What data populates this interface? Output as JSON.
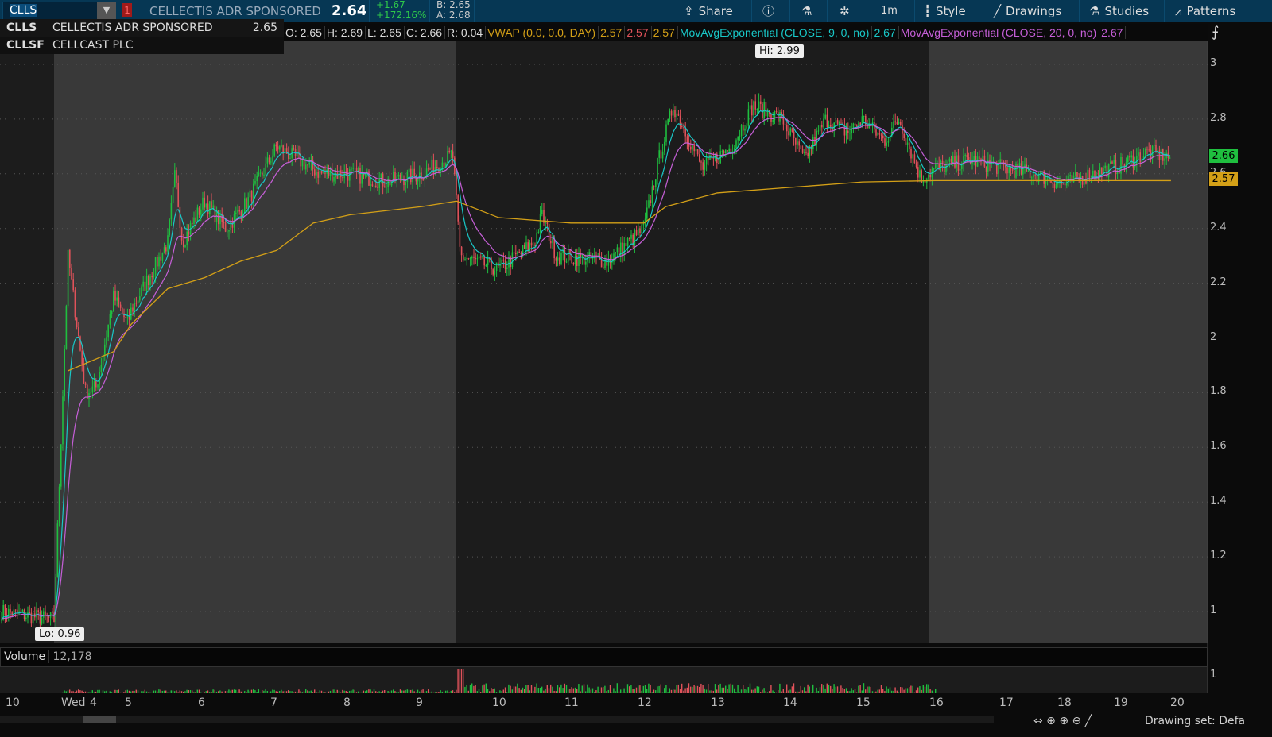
{
  "toolbar": {
    "symbol": "CLLS",
    "alert_count": "1",
    "description": "CELLECTIS ADR SPONSORED",
    "last": "2.64",
    "change": "+1.67",
    "change_pct": "+172.16%",
    "bid": "B: 2.65",
    "ask": "A: 2.68",
    "buttons": {
      "share": "Share",
      "interval": "1m",
      "style": "Style",
      "drawings": "Drawings",
      "studies": "Studies",
      "patterns": "Patterns"
    }
  },
  "dropdown": [
    {
      "symbol": "CLLS",
      "name": "CELLECTIS ADR SPONSORED",
      "price": "2.65"
    },
    {
      "symbol": "CLLSF",
      "name": "CELLCAST PLC",
      "price": ""
    }
  ],
  "legend": {
    "o": "O: 2.65",
    "h": "H: 2.69",
    "l": "L: 2.65",
    "c": "C: 2.66",
    "r": "R: 0.04",
    "vwap": "VWAP (0.0, 0.0, DAY)",
    "vwap_v1": "2.57",
    "vwap_v2": "2.57",
    "vwap_v3": "2.57",
    "ema9": "MovAvgExponential (CLOSE, 9, 0, no)",
    "ema9_v": "2.67",
    "ema20": "MovAvgExponential (CLOSE, 20, 0, no)",
    "ema20_v": "2.67"
  },
  "colors": {
    "up": "#1fbf3f",
    "down": "#e0525a",
    "vwap": "#d4a017",
    "ema9": "#19c8c8",
    "ema20": "#c65fd8"
  },
  "chart_data": {
    "type": "candlestick",
    "title": "CLLS 1m",
    "y_ticks": [
      "3",
      "2.8",
      "2.6",
      "2.4",
      "2.2",
      "2",
      "1.8",
      "1.6",
      "1.4",
      "1.2",
      "1"
    ],
    "ylim": [
      0.9,
      3.08
    ],
    "x_ticks": [
      "10",
      "Wed",
      "4",
      "5",
      "6",
      "7",
      "8",
      "9",
      "10",
      "11",
      "12",
      "13",
      "14",
      "15",
      "16",
      "17",
      "18",
      "19",
      "20"
    ],
    "price_path": [
      [
        3.3,
        1.0
      ],
      [
        3.88,
        0.97
      ],
      [
        3.92,
        2.3
      ],
      [
        3.97,
        1.8
      ],
      [
        4.2,
        1.95
      ],
      [
        4.5,
        2.15
      ],
      [
        4.9,
        2.05
      ],
      [
        5.2,
        2.2
      ],
      [
        5.5,
        2.35
      ],
      [
        5.6,
        2.6
      ],
      [
        5.7,
        2.35
      ],
      [
        6,
        2.5
      ],
      [
        6.3,
        2.4
      ],
      [
        6.6,
        2.5
      ],
      [
        7,
        2.7
      ],
      [
        7.3,
        2.65
      ],
      [
        7.6,
        2.6
      ],
      [
        8,
        2.6
      ],
      [
        8.5,
        2.57
      ],
      [
        9,
        2.6
      ],
      [
        9.4,
        2.67
      ],
      [
        9.5,
        2.3
      ],
      [
        10,
        2.25
      ],
      [
        10.5,
        2.35
      ],
      [
        10.6,
        2.45
      ],
      [
        10.8,
        2.3
      ],
      [
        11.5,
        2.28
      ],
      [
        12,
        2.4
      ],
      [
        12.2,
        2.65
      ],
      [
        12.4,
        2.85
      ],
      [
        12.8,
        2.62
      ],
      [
        13.2,
        2.7
      ],
      [
        13.5,
        2.85
      ],
      [
        13.9,
        2.8
      ],
      [
        14.2,
        2.65
      ],
      [
        14.5,
        2.8
      ],
      [
        14.8,
        2.75
      ],
      [
        15,
        2.8
      ],
      [
        15.3,
        2.72
      ],
      [
        15.5,
        2.8
      ],
      [
        15.8,
        2.58
      ],
      [
        16,
        2.62
      ],
      [
        16.5,
        2.65
      ],
      [
        17,
        2.62
      ],
      [
        17.5,
        2.6
      ],
      [
        18,
        2.56
      ],
      [
        18.5,
        2.6
      ],
      [
        19,
        2.63
      ],
      [
        19.5,
        2.68
      ],
      [
        19.9,
        2.66
      ]
    ],
    "vwap_path": [
      [
        3.92,
        1.88
      ],
      [
        4.5,
        1.95
      ],
      [
        5,
        2.05
      ],
      [
        5.5,
        2.18
      ],
      [
        6,
        2.22
      ],
      [
        6.5,
        2.28
      ],
      [
        7,
        2.32
      ],
      [
        7.5,
        2.42
      ],
      [
        8,
        2.45
      ],
      [
        9,
        2.48
      ],
      [
        9.45,
        2.5
      ],
      [
        10,
        2.44
      ],
      [
        11,
        2.42
      ],
      [
        12,
        2.42
      ],
      [
        12.3,
        2.48
      ],
      [
        13,
        2.53
      ],
      [
        14,
        2.55
      ],
      [
        15,
        2.57
      ],
      [
        16,
        2.575
      ],
      [
        19.9,
        2.575
      ]
    ],
    "hi_label": "Hi: 2.99",
    "lo_label": "Lo: 0.96",
    "last_tag": "2.66",
    "vwap_tag": "2.57"
  },
  "volume": {
    "label": "Volume",
    "value": "12,178",
    "axis_tick": "1"
  },
  "status": {
    "drawing_set": "Drawing set: Defa"
  }
}
